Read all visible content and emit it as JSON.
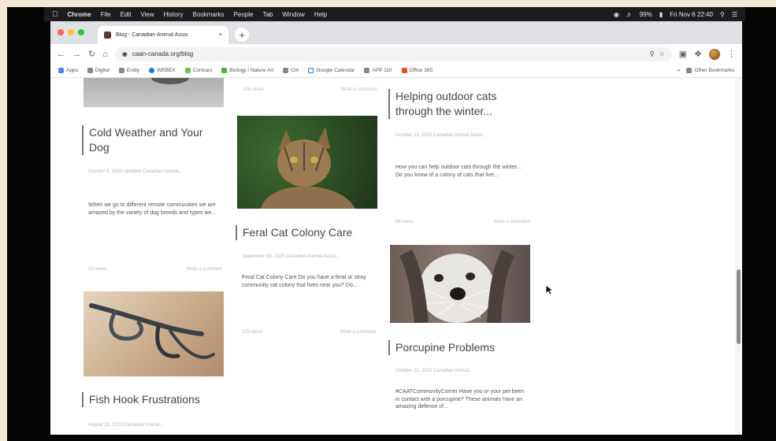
{
  "menubar": {
    "app": "Chrome",
    "items": [
      "File",
      "Edit",
      "View",
      "History",
      "Bookmarks",
      "People",
      "Tab",
      "Window",
      "Help"
    ],
    "battery": "99%",
    "datetime": "Fri Nov 6 22:40"
  },
  "browser": {
    "tab_title": "Blog - Canadian Animal Assis",
    "url": "caan-canada.org/blog"
  },
  "bookmarks": [
    "Apps",
    "Digital",
    "Entity",
    "WEBEX",
    "Contract",
    "Biology / Nature Art",
    "Ctrl",
    "Google Calendar",
    "APP 110",
    "Office 365"
  ],
  "bookmarks_other": "Other Bookmarks",
  "posts": {
    "cold": {
      "title": "Cold Weather and Your Dog",
      "meta": "October 8, 2020 Updated Canadian Animal...",
      "excerpt": "When we go to different remote communities we are amazed by the variety of dog breeds and types we...",
      "views": "22 views",
      "comments": "Write a comment"
    },
    "feral_top": {
      "views": "105 views",
      "comments": "Write a comment"
    },
    "feral": {
      "title": "Feral Cat Colony Care",
      "meta": "September 30, 2020 Canadian Animal Assist...",
      "excerpt": "Feral Cat Colony Care Do you have a feral or stray community cat colony that lives near you? Do...",
      "views": "125 views",
      "comments": "Write a comment"
    },
    "outdoor": {
      "title": "Helping outdoor cats through the winter...",
      "meta": "October 13, 2020 Canadian Animal Assist...",
      "excerpt": "How you can help outdoor cats through the winter... Do you know of a colony of cats that live...",
      "views": "89 views",
      "comments": "Write a comment"
    },
    "porcupine": {
      "title": "Porcupine Problems",
      "meta": "October 22, 2020 Canadian Animal...",
      "excerpt": "#CAATCommunityCorner Have you or your pet been in contact with a porcupine? These animals have an amazing defense of..."
    },
    "fishhook": {
      "title": "Fish Hook Frustrations",
      "meta": "August 10, 2020 Canadian Animal..."
    }
  }
}
